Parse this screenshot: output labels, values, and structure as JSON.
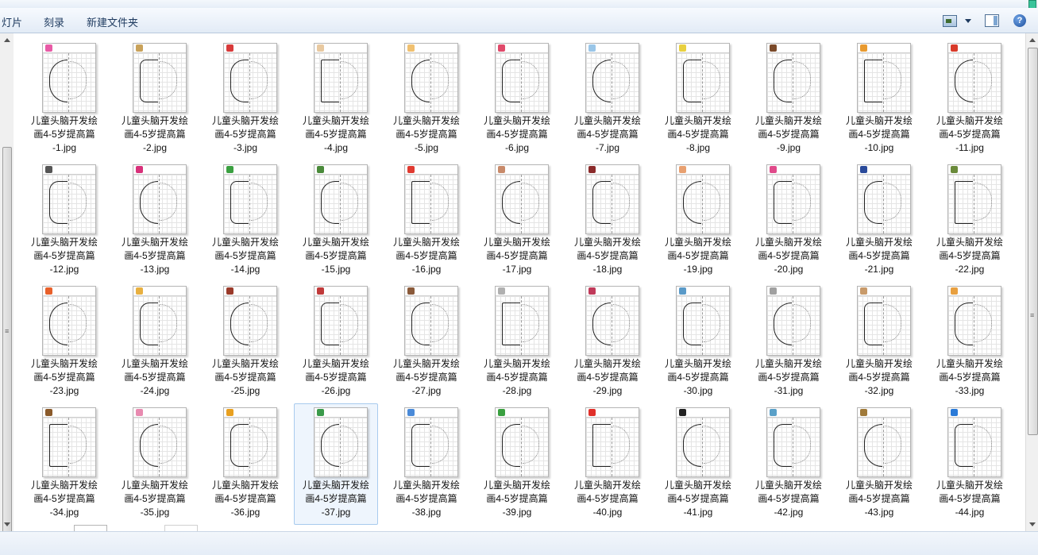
{
  "toolbar": {
    "item1": "灯片",
    "item2": "刻录",
    "item3": "新建文件夹"
  },
  "caption": {
    "line1": "儿童头脑开发绘",
    "line2": "画4-5岁提高篇"
  },
  "files": [
    {
      "name": "-1.jpg",
      "color": "#e85aa6"
    },
    {
      "name": "-2.jpg",
      "color": "#c9a25a"
    },
    {
      "name": "-3.jpg",
      "color": "#d83a3a"
    },
    {
      "name": "-4.jpg",
      "color": "#e8c9a0"
    },
    {
      "name": "-5.jpg",
      "color": "#f0c070"
    },
    {
      "name": "-6.jpg",
      "color": "#e04a6a"
    },
    {
      "name": "-7.jpg",
      "color": "#9ac6e8"
    },
    {
      "name": "-8.jpg",
      "color": "#e8d040"
    },
    {
      "name": "-9.jpg",
      "color": "#7a4a2a"
    },
    {
      "name": "-10.jpg",
      "color": "#e89a30"
    },
    {
      "name": "-11.jpg",
      "color": "#d83a2a"
    },
    {
      "name": "-12.jpg",
      "color": "#555555"
    },
    {
      "name": "-13.jpg",
      "color": "#d8307a"
    },
    {
      "name": "-14.jpg",
      "color": "#3aa040"
    },
    {
      "name": "-15.jpg",
      "color": "#4a8a3a"
    },
    {
      "name": "-16.jpg",
      "color": "#e03a30"
    },
    {
      "name": "-17.jpg",
      "color": "#c88a6a"
    },
    {
      "name": "-18.jpg",
      "color": "#8a2a2a"
    },
    {
      "name": "-19.jpg",
      "color": "#e8a070"
    },
    {
      "name": "-20.jpg",
      "color": "#e04a8a"
    },
    {
      "name": "-21.jpg",
      "color": "#2a4a9a"
    },
    {
      "name": "-22.jpg",
      "color": "#6a8a3a"
    },
    {
      "name": "-23.jpg",
      "color": "#e8602a"
    },
    {
      "name": "-24.jpg",
      "color": "#e8b040"
    },
    {
      "name": "-25.jpg",
      "color": "#9a3a2a"
    },
    {
      "name": "-26.jpg",
      "color": "#c03a3a"
    },
    {
      "name": "-27.jpg",
      "color": "#8a5a3a"
    },
    {
      "name": "-28.jpg",
      "color": "#b0b0b0"
    },
    {
      "name": "-29.jpg",
      "color": "#c03a5a"
    },
    {
      "name": "-30.jpg",
      "color": "#5a9ac8"
    },
    {
      "name": "-31.jpg",
      "color": "#a0a0a0"
    },
    {
      "name": "-32.jpg",
      "color": "#c89a6a"
    },
    {
      "name": "-33.jpg",
      "color": "#e8a040"
    },
    {
      "name": "-34.jpg",
      "color": "#8a5a2a"
    },
    {
      "name": "-35.jpg",
      "color": "#e88ab0"
    },
    {
      "name": "-36.jpg",
      "color": "#e8a020"
    },
    {
      "name": "-37.jpg",
      "color": "#3a9a4a"
    },
    {
      "name": "-38.jpg",
      "color": "#4a8ad8"
    },
    {
      "name": "-39.jpg",
      "color": "#3aa040"
    },
    {
      "name": "-40.jpg",
      "color": "#e0302a"
    },
    {
      "name": "-41.jpg",
      "color": "#222222"
    },
    {
      "name": "-42.jpg",
      "color": "#5aa0c8"
    },
    {
      "name": "-43.jpg",
      "color": "#a07a3a"
    },
    {
      "name": "-44.jpg",
      "color": "#2a7ad8"
    }
  ],
  "selected_file": "-37.jpg"
}
